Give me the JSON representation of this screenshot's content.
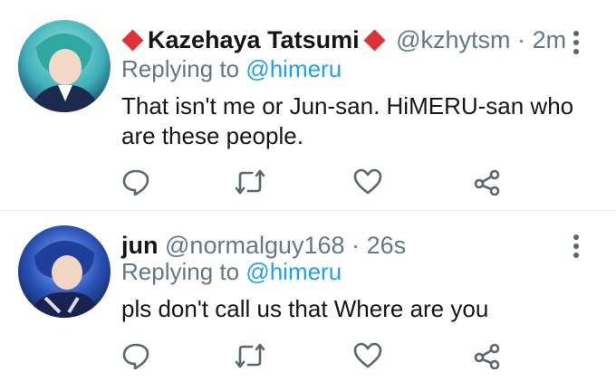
{
  "tweets": [
    {
      "display_name": "Kazehaya Tatsumi",
      "handle": "@kzhytsm",
      "separator": "·",
      "time": "2m",
      "reply_prefix": "Replying to",
      "reply_mention": "@himeru",
      "text": "That isn't me or Jun-san. HiMERU-san who are these people.",
      "avatar_colors": [
        "#3fb3b8",
        "#1f3a6e"
      ]
    },
    {
      "display_name": "jun",
      "handle": "@normalguy168",
      "separator": "·",
      "time": "26s",
      "reply_prefix": "Replying to",
      "reply_mention": "@himeru",
      "text": "pls don't call us that Where are you",
      "avatar_colors": [
        "#2a52b8",
        "#101c4a"
      ]
    }
  ],
  "icons": [
    "reply-icon",
    "retweet-icon",
    "like-icon",
    "share-icon",
    "more-icon"
  ],
  "colors": {
    "accent": "#1da1f2",
    "secondary_text": "#657786",
    "diamond": "#e0313b"
  }
}
